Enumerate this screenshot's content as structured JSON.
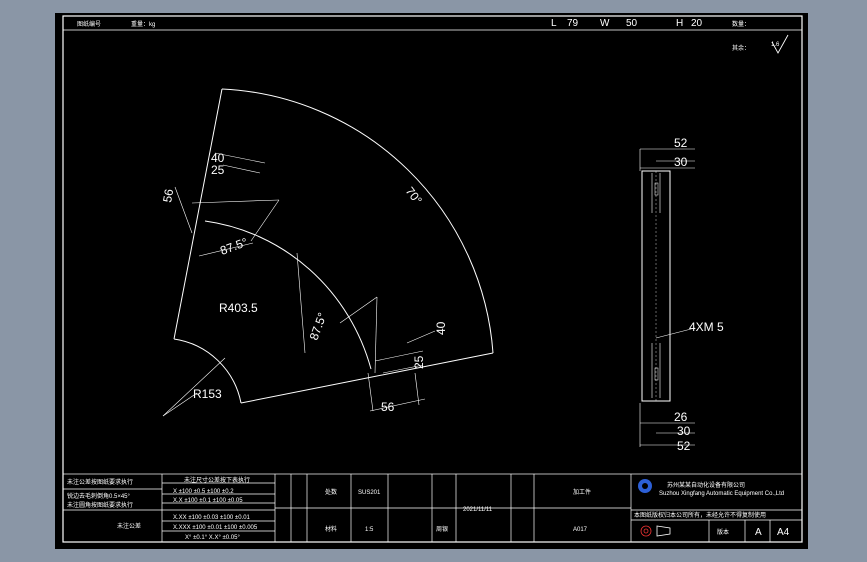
{
  "header": {
    "label_left": "图纸编号",
    "label_weight": "重量：kg",
    "l_label": "L",
    "l_value": "79",
    "w_label": "W",
    "w_value": "50",
    "h_label": "H",
    "h_value": "20",
    "qty_label": "数量：",
    "surface_label": "其余：",
    "roughness_value": "1.6"
  },
  "drawing": {
    "plan_dims": {
      "top_40": "40",
      "top_25": "25",
      "left_56": "56",
      "radius_outer": "R403.5",
      "radius_inner": "R153",
      "angle_top": "87.5°",
      "angle_bottom": "87.5°",
      "angle_arc": "70°",
      "right_40": "40",
      "right_25": "25",
      "bottom_56": "56"
    },
    "side_dims": {
      "top_52": "52",
      "top_30": "30",
      "thread_note": "4XM 5",
      "bottom_26": "26",
      "bottom_30": "30",
      "bottom_52": "52"
    }
  },
  "title_block": {
    "notes": [
      "未注公差按图纸要求执行",
      "锐边去毛刺倒角0.5×45°",
      "未注圆角按图纸要求执行"
    ],
    "tolerance_title": "未注尺寸公差按下表执行",
    "tolerance_rows": [
      "X    ±100 ±0.5 ±100 ±0.2",
      "X.X    ±100 ±0.1 ±100 ±0.05",
      "X.XX    ±100 ±0.03 ±100 ±0.01",
      "X.XXX   ±100 ±0.01 ±100 ±0.005"
    ],
    "tolerance_angles": "X° ±0.1°   X.X° ±0.05°",
    "general_label": "未注公差",
    "col_labels": [
      "处数",
      "材料",
      "审核",
      "设计"
    ],
    "material": "SUS201",
    "date": "2021/11/11",
    "scale": "1:5",
    "part_number": "A017",
    "process": "加工件",
    "designer": "周银",
    "company_cn": "苏州某某自动化设备有限公司",
    "company_en": "Suzhou Xingfang Automatic Equipment Co.,Ltd",
    "revision_label": "版本",
    "revision_value": "A",
    "paper_size": "A4",
    "disclaimer": "本图纸版权归本公司所有，未经允许不得复制使用"
  },
  "colors": {
    "background": "#8a96a6",
    "sheet": "#000000",
    "lines": "#ffffff",
    "logo": "#2c5fd6"
  }
}
